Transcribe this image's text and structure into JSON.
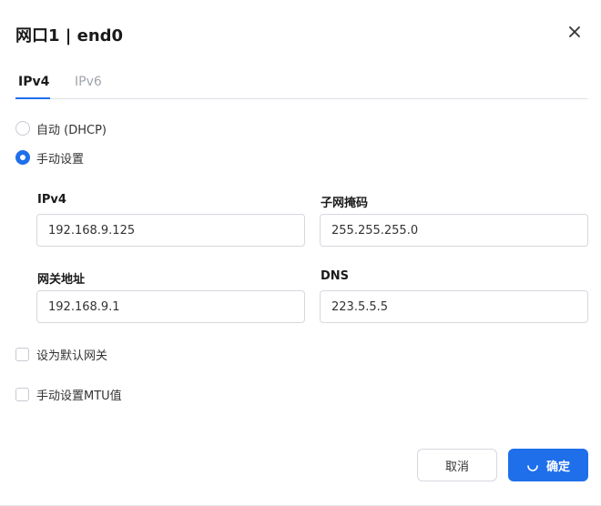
{
  "dialog": {
    "title": "网口1 | end0"
  },
  "tabs": [
    {
      "label": "IPv4",
      "active": true
    },
    {
      "label": "IPv6",
      "active": false
    }
  ],
  "mode": {
    "options": [
      {
        "label": "自动 (DHCP)",
        "selected": false
      },
      {
        "label": "手动设置",
        "selected": true
      }
    ]
  },
  "fields": {
    "ipv4": {
      "label": "IPv4",
      "value": "192.168.9.125"
    },
    "netmask": {
      "label": "子网掩码",
      "value": "255.255.255.0"
    },
    "gateway": {
      "label": "网关地址",
      "value": "192.168.9.1"
    },
    "dns": {
      "label": "DNS",
      "value": "223.5.5.5"
    }
  },
  "options": {
    "default_gateway": {
      "label": "设为默认网关",
      "checked": false
    },
    "manual_mtu": {
      "label": "手动设置MTU值",
      "checked": false
    }
  },
  "footer": {
    "cancel_label": "取消",
    "confirm_label": "确定"
  },
  "colors": {
    "accent": "#1f6feb",
    "border": "#d5d8de",
    "inactive_tab": "#a0a4ab"
  },
  "icons": {
    "close": "close-icon",
    "loading": "spinner-icon"
  }
}
